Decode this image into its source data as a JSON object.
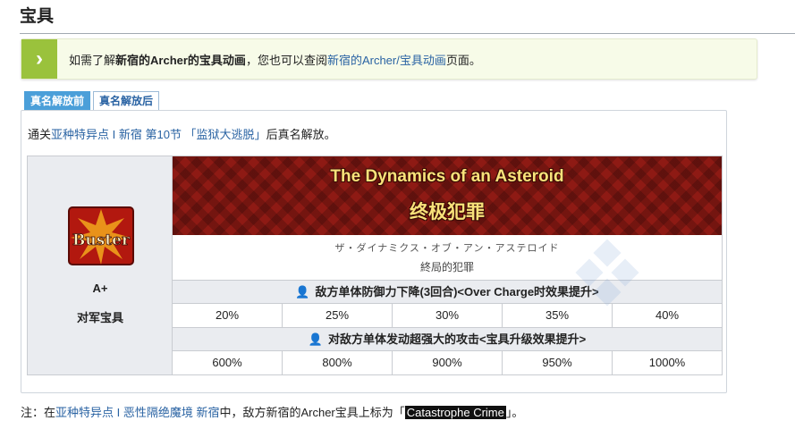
{
  "section": {
    "title": "宝具"
  },
  "notice": {
    "icon": "chevron-right-icon",
    "prefix": "如需了解",
    "servant_bold": "新宿的Archer的宝具动画",
    "middle": "，您也可以查阅",
    "link": "新宿的Archer/宝具动画",
    "suffix": "页面。"
  },
  "tabs": [
    {
      "label": "真名解放前"
    },
    {
      "label": "真名解放后"
    }
  ],
  "unlock": {
    "prefix": "通关",
    "link1": "亚种特异点 I  新宿",
    "link2": "第10节 「监狱大逃脱」",
    "suffix": "后真名解放。"
  },
  "np": {
    "card_icon": "buster-card-icon",
    "card_label": "Buster",
    "rank": "A+",
    "type": "对军宝具",
    "name_en": "The Dynamics of an Asteroid",
    "name_cn": "终极犯罪",
    "ruby": "ザ・ダイナミクス・オブ・アン・アステロイド",
    "name_jp": "終局的犯罪",
    "effects": [
      {
        "icon": "person-icon",
        "label": "敌方单体防御力下降(3回合)<Over Charge时效果提升>",
        "values": [
          "20%",
          "25%",
          "30%",
          "35%",
          "40%"
        ]
      },
      {
        "icon": "person-icon",
        "label": "对敌方单体发动超强大的攻击<宝具升级效果提升>",
        "values": [
          "600%",
          "800%",
          "900%",
          "950%",
          "1000%"
        ]
      }
    ]
  },
  "footnote": {
    "prefix": "注：在",
    "link1": "亚种特异点 I  恶性隔绝魔境 新宿",
    "middle": "中，敌方新宿的Archer宝具上标为「",
    "highlight": "Catastrophe Crime",
    "suffix": "」。"
  },
  "colors": {
    "accent_link": "#2a63a3",
    "notice_green": "#9ac23c",
    "tab_blue": "#4b9fd9",
    "banner_red": "#8e1a14",
    "banner_text": "#f8e27a"
  }
}
